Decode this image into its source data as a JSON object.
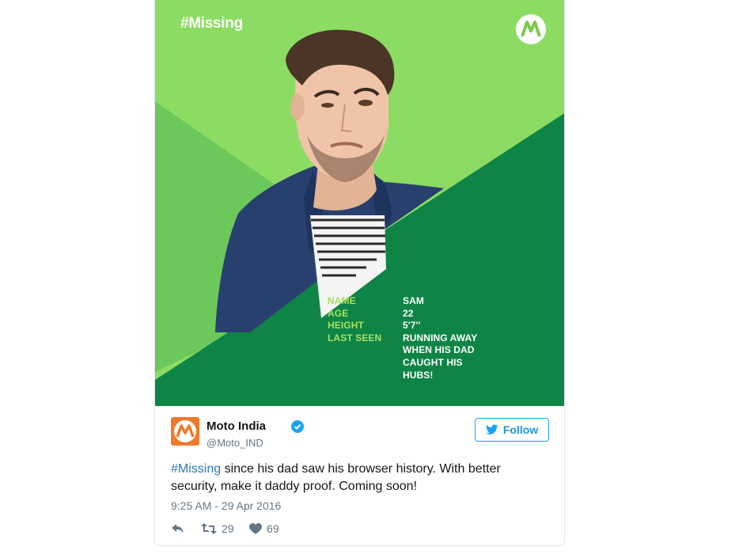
{
  "image": {
    "hashtag": "#Missing",
    "info_labels": [
      "NAME",
      "AGE",
      "HEIGHT",
      "LAST SEEN"
    ],
    "info_values": [
      "SAM",
      "22",
      "5'7''",
      "RUNNING AWAY WHEN HIS DAD CAUGHT HIS HUBS!"
    ],
    "logo_icon": "motorola-logo-icon",
    "colors": {
      "light_green": "#8cdc64",
      "mid_green": "#6cc85a",
      "dark_green": "#0e8446",
      "label_green": "#a8e060"
    }
  },
  "tweet": {
    "display_name": "Moto India",
    "handle": "@Moto_IND",
    "follow_label": "Follow",
    "text_hashtag": "#Missing",
    "text_rest": " since his dad saw his browser history. With better security, make it daddy proof. Coming soon!",
    "timestamp": "9:25 AM - 29 Apr 2016",
    "retweets": "29",
    "likes": "69",
    "avatar_color": "#f07a2a",
    "link_color": "#2b7bb9"
  }
}
